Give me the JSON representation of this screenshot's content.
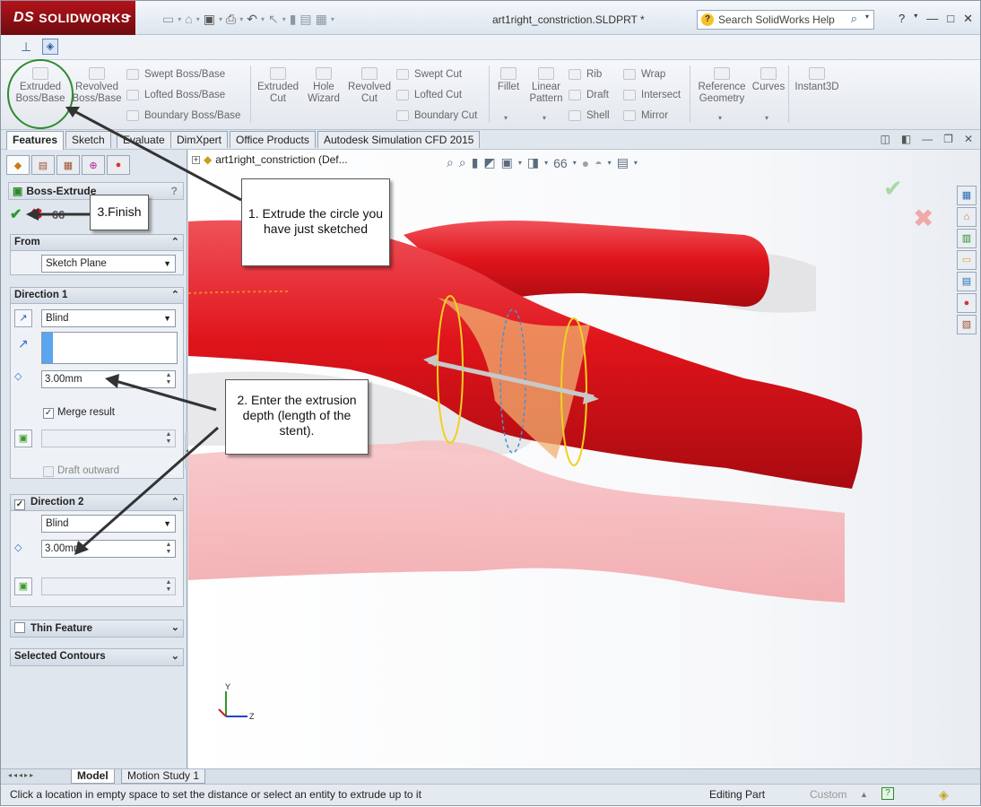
{
  "app": {
    "brand": "SOLIDWORKS",
    "brand_mark": "DS",
    "document_title": "art1right_constriction.SLDPRT *"
  },
  "help_search": {
    "placeholder": "Search SolidWorks Help"
  },
  "command_manager": {
    "features": {
      "extruded_boss": "Extruded Boss/Base",
      "revolved_boss": "Revolved Boss/Base",
      "swept_boss": "Swept Boss/Base",
      "lofted_boss": "Lofted Boss/Base",
      "boundary_boss": "Boundary Boss/Base",
      "extruded_cut": "Extruded Cut",
      "hole_wizard": "Hole Wizard",
      "revolved_cut": "Revolved Cut",
      "swept_cut": "Swept Cut",
      "lofted_cut": "Lofted Cut",
      "boundary_cut": "Boundary Cut",
      "fillet": "Fillet",
      "linear_pattern": "Linear Pattern",
      "rib": "Rib",
      "draft": "Draft",
      "shell": "Shell",
      "wrap": "Wrap",
      "intersect": "Intersect",
      "mirror": "Mirror",
      "reference_geometry": "Reference Geometry",
      "curves": "Curves",
      "instant3d": "Instant3D"
    },
    "tabs": [
      "Features",
      "Sketch",
      "Evaluate",
      "DimXpert",
      "Office Products",
      "Autodesk Simulation CFD 2015"
    ]
  },
  "feature_tree": {
    "root": "art1right_constriction  (Def..."
  },
  "property_manager": {
    "title": "Boss-Extrude",
    "help": "?",
    "from": {
      "header": "From",
      "value": "Sketch Plane"
    },
    "direction1": {
      "header": "Direction 1",
      "end_condition": "Blind",
      "depth": "3.00mm",
      "merge_result": "Merge result",
      "merge_checked": true,
      "draft_outward": "Draft outward",
      "draft_checked": false
    },
    "direction2": {
      "header": "Direction 2",
      "checked": true,
      "end_condition": "Blind",
      "depth": "3.00mm"
    },
    "thin_feature": {
      "header": "Thin Feature",
      "checked": false
    },
    "selected_contours": {
      "header": "Selected Contours"
    }
  },
  "callouts": {
    "c1": "1. Extrude the circle you have just sketched",
    "c2": "2. Enter the extrusion depth (length of the stent).",
    "c3": "3.Finish"
  },
  "triad": {
    "y": "Y",
    "z": "Z"
  },
  "bottom_tabs": [
    "Model",
    "Motion Study 1"
  ],
  "status": {
    "message": "Click a location in empty space to set the distance or select an entity to extrude up to it",
    "mode": "Editing Part",
    "units": "Custom"
  },
  "colors": {
    "vessel": "#e0141b",
    "vessel_shadow": "#f3a8ab",
    "accent_green": "#2f8a2f",
    "callout_arrow": "#333333"
  }
}
